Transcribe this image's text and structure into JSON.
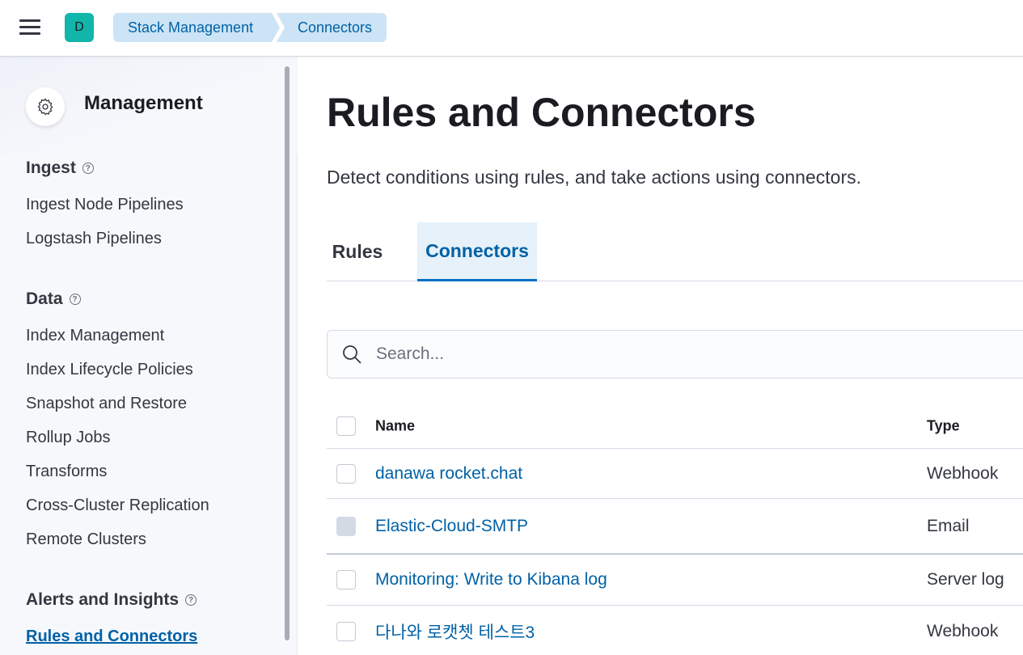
{
  "header": {
    "avatar_initial": "D",
    "breadcrumbs": [
      "Stack Management",
      "Connectors"
    ]
  },
  "sidebar": {
    "title": "Management",
    "sections": [
      {
        "title": "Ingest",
        "items": [
          "Ingest Node Pipelines",
          "Logstash Pipelines"
        ]
      },
      {
        "title": "Data",
        "items": [
          "Index Management",
          "Index Lifecycle Policies",
          "Snapshot and Restore",
          "Rollup Jobs",
          "Transforms",
          "Cross-Cluster Replication",
          "Remote Clusters"
        ]
      },
      {
        "title": "Alerts and Insights",
        "items": [
          "Rules and Connectors"
        ]
      }
    ],
    "active_item": "Rules and Connectors"
  },
  "main": {
    "title": "Rules and Connectors",
    "description": "Detect conditions using rules, and take actions using connectors.",
    "tabs": [
      "Rules",
      "Connectors"
    ],
    "active_tab": "Connectors",
    "search": {
      "placeholder": "Search..."
    },
    "table": {
      "columns": [
        "Name",
        "Type"
      ],
      "rows": [
        {
          "name": "danawa rocket.chat",
          "type": "Webhook"
        },
        {
          "name": "Elastic-Cloud-SMTP",
          "type": "Email"
        },
        {
          "name": "Monitoring: Write to Kibana log",
          "type": "Server log"
        },
        {
          "name": "다나와 로캣쳇 테스트3",
          "type": "Webhook"
        }
      ]
    }
  },
  "colors": {
    "accent": "#0061a6",
    "avatar": "#12b5a9",
    "breadcrumb_bg": "#cce4f5"
  }
}
